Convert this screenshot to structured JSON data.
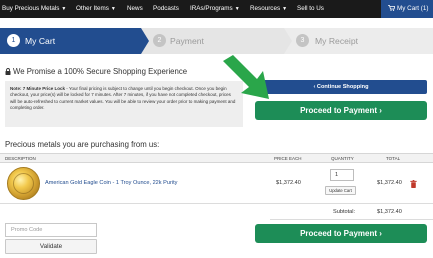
{
  "nav": {
    "items": [
      {
        "label": "Buy Precious Metals",
        "dropdown": true
      },
      {
        "label": "Other Items",
        "dropdown": true
      },
      {
        "label": "News",
        "dropdown": false
      },
      {
        "label": "Podcasts",
        "dropdown": false
      },
      {
        "label": "IRAs/Programs",
        "dropdown": true
      },
      {
        "label": "Resources",
        "dropdown": true
      },
      {
        "label": "Sell to Us",
        "dropdown": false
      }
    ],
    "cart_label": "My Cart (1)",
    "cart_icon": "cart-icon"
  },
  "steps": [
    {
      "number": "1",
      "label": "My Cart",
      "active": true
    },
    {
      "number": "2",
      "label": "Payment",
      "active": false
    },
    {
      "number": "3",
      "label": "My Receipt",
      "active": false
    }
  ],
  "promise": {
    "icon": "lock-icon",
    "text": "We Promise a 100% Secure Shopping Experience"
  },
  "note": {
    "title": "Note: 7 Minute Price Lock",
    "body": " - Your final pricing is subject to change until you begin checkout. Once you begin checkout, your price(s) will be locked for 7 minutes. After 7 minutes, if you have not completed checkout, prices will be auto-refreshed to current market values. You will be able to review your order prior to making payment and completing order."
  },
  "buttons": {
    "continue_shopping": "‹ Continue Shopping",
    "proceed_payment": "Proceed to Payment ›"
  },
  "cart": {
    "title": "Precious metals you are purchasing from us:",
    "headers": {
      "description": "DESCRIPTION",
      "price_each": "PRICE EACH",
      "quantity": "QUANTITY",
      "total": "TOTAL"
    },
    "items": [
      {
        "name": "American Gold Eagle Coin - 1 Troy Ounce, 22k Purity",
        "price_each": "$1,372.40",
        "quantity": "1",
        "update_label": "Update Cart",
        "total": "$1,372.40"
      }
    ],
    "subtotal_label": "Subtotal:",
    "subtotal_value": "$1,372.40"
  },
  "promo": {
    "placeholder": "Promo Code",
    "validate_label": "Validate"
  },
  "colors": {
    "nav_bg": "#1a1a1a",
    "brand_blue": "#224d8f",
    "accent_green": "#1d8d57",
    "arrow_green": "#2aa64a",
    "trash_red": "#c0392b"
  }
}
